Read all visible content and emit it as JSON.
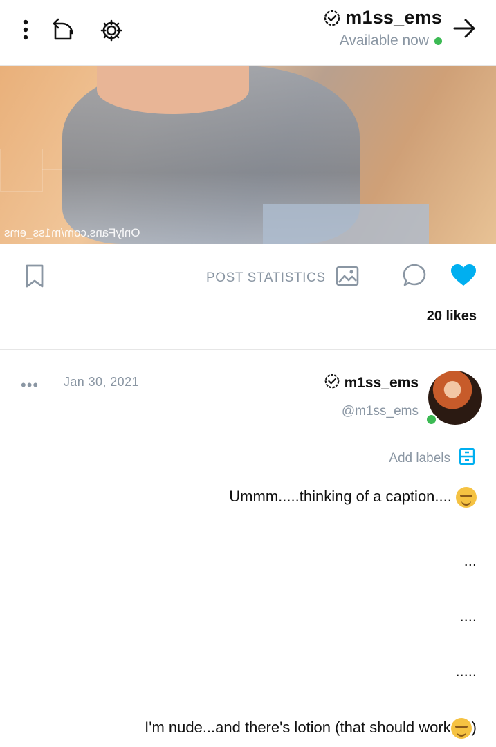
{
  "header": {
    "title": "m1ss_ems",
    "status": "Available now"
  },
  "photo": {
    "watermark": "OnlyFans.com/m1ss_ems"
  },
  "actions": {
    "post_stats_label": "POST STATISTICS",
    "likes": "20 likes"
  },
  "post": {
    "author_name": "m1ss_ems",
    "author_handle": "@m1ss_ems",
    "date": "Jan 30, 2021",
    "more": "•••",
    "add_labels": "Add labels",
    "caption_lines": [
      "Ummm.....thinking of a caption....",
      "...",
      "....",
      ".....",
      "I'm nude...and there's lotion (that should work"
    ],
    "caption_tail": ")"
  },
  "colors": {
    "accent": "#00aff0",
    "muted": "#8a96a3",
    "online": "#3cba54"
  },
  "icons": [
    "back-arrow-icon",
    "verified-icon",
    "settings-icon",
    "share-icon",
    "more-vertical-icon",
    "heart-icon",
    "comment-icon",
    "image-icon",
    "bookmark-icon",
    "labels-icon"
  ]
}
